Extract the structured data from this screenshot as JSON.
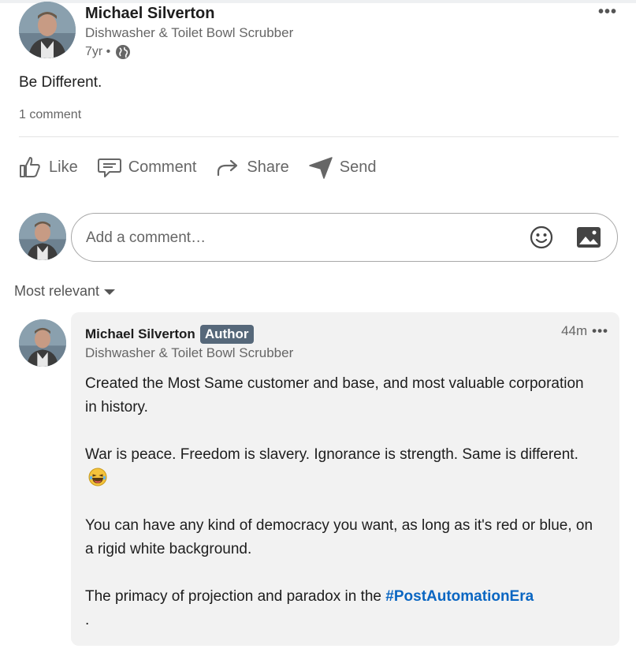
{
  "post": {
    "author_name": "Michael Silverton",
    "author_headline": "Dishwasher & Toilet Bowl Scrubber",
    "time_ago": "7yr •",
    "text": "Be Different.",
    "comment_count": "1 comment"
  },
  "actions": {
    "like": "Like",
    "comment": "Comment",
    "share": "Share",
    "send": "Send"
  },
  "composer": {
    "placeholder": "Add a comment…"
  },
  "sort": {
    "label": "Most relevant"
  },
  "comment": {
    "author_name": "Michael Silverton",
    "author_badge": "Author",
    "author_headline": "Dishwasher & Toilet Bowl Scrubber",
    "time_ago": "44m",
    "paragraph_1": "Created the Most Same customer and base, and most valuable corporation in history.",
    "paragraph_2": "War is peace. Freedom is slavery. Ignorance is strength. Same is different.",
    "paragraph_3": "You can have any kind of democracy you want, as long as it's red or blue, on a rigid white background.",
    "paragraph_4_prefix": "The primacy of projection and paradox in the ",
    "hashtag": "#PostAutomationEra",
    "paragraph_4_suffix": "."
  },
  "colors": {
    "link": "#0a66c2",
    "badge": "#56687a",
    "bubble": "#f2f2f2"
  }
}
